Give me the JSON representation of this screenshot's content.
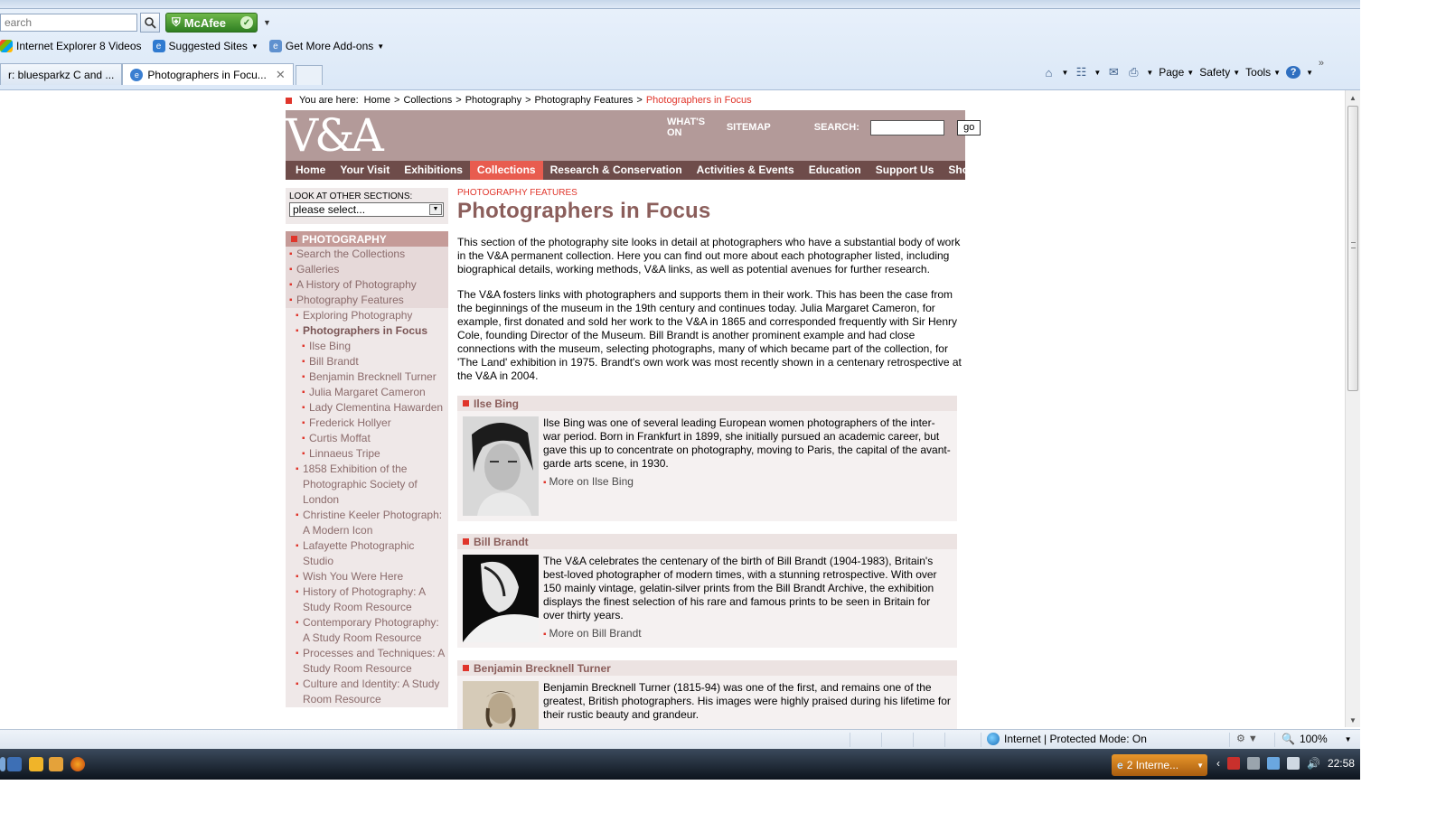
{
  "browser": {
    "search_placeholder": "earch",
    "mcafee_label": "McAfee",
    "favorites": [
      {
        "label": "Internet Explorer 8 Videos"
      },
      {
        "label": "Suggested Sites"
      },
      {
        "label": "Get More Add-ons"
      }
    ],
    "tabs": [
      {
        "label": "r: bluesparkz C and ..."
      },
      {
        "label": "Photographers in Focu..."
      }
    ],
    "commands": {
      "page": "Page",
      "safety": "Safety",
      "tools": "Tools"
    },
    "status": {
      "zone": "Internet | Protected Mode: On",
      "zoom": "100%"
    },
    "taskbar": {
      "task_label": "2 Interne...",
      "clock": "22:58"
    }
  },
  "site": {
    "breadcrumb": {
      "prefix": "You are here:",
      "items": [
        "Home",
        "Collections",
        "Photography",
        "Photography Features"
      ],
      "current": "Photographers in Focus"
    },
    "logo": "V&A",
    "header_links": {
      "whats_on": "WHAT'S ON",
      "sitemap": "SITEMAP",
      "search_label": "SEARCH:",
      "go": "go"
    },
    "nav": [
      "Home",
      "Your Visit",
      "Exhibitions",
      "Collections",
      "Research & Conservation",
      "Activities & Events",
      "Education",
      "Support Us",
      "Shop Online"
    ],
    "nav_active": "Collections",
    "accent_color": "#e0352b"
  },
  "sidebar": {
    "lookat_label": "LOOK AT OTHER SECTIONS:",
    "select_value": "please select...",
    "heading": "PHOTOGRAPHY",
    "items": [
      {
        "label": "Search the Collections",
        "level": 1
      },
      {
        "label": "Galleries",
        "level": 1
      },
      {
        "label": "A History of Photography",
        "level": 1
      },
      {
        "label": "Photography Features",
        "level": 1
      },
      {
        "label": "Exploring Photography",
        "level": 2
      },
      {
        "label": "Photographers in Focus",
        "level": 2
      },
      {
        "label": "Ilse Bing",
        "level": 3
      },
      {
        "label": "Bill Brandt",
        "level": 3
      },
      {
        "label": "Benjamin Brecknell Turner",
        "level": 3
      },
      {
        "label": "Julia Margaret Cameron",
        "level": 3
      },
      {
        "label": "Lady Clementina Hawarden",
        "level": 3
      },
      {
        "label": "Frederick Hollyer",
        "level": 3
      },
      {
        "label": "Curtis Moffat",
        "level": 3
      },
      {
        "label": "Linnaeus Tripe",
        "level": 3
      },
      {
        "label": "1858 Exhibition of the Photographic Society of London",
        "level": 2
      },
      {
        "label": "Christine Keeler Photograph: A Modern Icon",
        "level": 2
      },
      {
        "label": "Lafayette Photographic Studio",
        "level": 2
      },
      {
        "label": "Wish You Were Here",
        "level": 2
      },
      {
        "label": "History of Photography: A Study Room Resource",
        "level": 2
      },
      {
        "label": "Contemporary Photography: A Study Room Resource",
        "level": 2
      },
      {
        "label": "Processes and Techniques: A Study Room Resource",
        "level": 2
      },
      {
        "label": "Culture and Identity: A Study Room Resource",
        "level": 2
      }
    ]
  },
  "main": {
    "kicker": "PHOTOGRAPHY FEATURES",
    "title": "Photographers in Focus",
    "intro": [
      "This section of the photography site looks in detail at photographers who have a substantial body of work in the V&A permanent collection. Here you can find out more about each photographer listed, including biographical details, working methods, V&A links, as well as potential avenues for further research.",
      "The V&A fosters links with photographers and supports them in their work. This has been the case from the beginnings of the museum in the 19th century and continues today. Julia Margaret Cameron, for example, first donated and sold her work to the V&A  in 1865 and corresponded frequently with Sir Henry Cole, founding Director of the Museum. Bill Brandt is another prominent example and had close connections with the museum, selecting photographs, many of which became part of the collection, for 'The Land' exhibition in 1975. Brandt's own work was most recently shown in a centenary retrospective at the V&A in 2004."
    ],
    "photographers": [
      {
        "name": "Ilse Bing",
        "text": "Ilse Bing was one of several leading European women photographers of the inter-war period. Born in Frankfurt in 1899, she initially pursued an academic career, but gave this up to concentrate on photography, moving to Paris, the capital of the avant-garde arts scene, in 1930.",
        "more": "More on Ilse Bing"
      },
      {
        "name": "Bill Brandt",
        "text": "The V&A celebrates the centenary of the birth of Bill Brandt (1904-1983), Britain's best-loved photographer of modern times, with a stunning retrospective. With over 150 mainly vintage, gelatin-silver prints from the Bill Brandt Archive, the exhibition displays the finest selection of his rare and famous prints to be seen in Britain for over thirty years.",
        "more": "More on Bill Brandt"
      },
      {
        "name": "Benjamin Brecknell Turner",
        "text": "Benjamin Brecknell Turner (1815-94) was one of the first, and remains one of the greatest, British photographers. His images were highly praised during his lifetime for their rustic beauty and grandeur.",
        "more": ""
      }
    ]
  }
}
